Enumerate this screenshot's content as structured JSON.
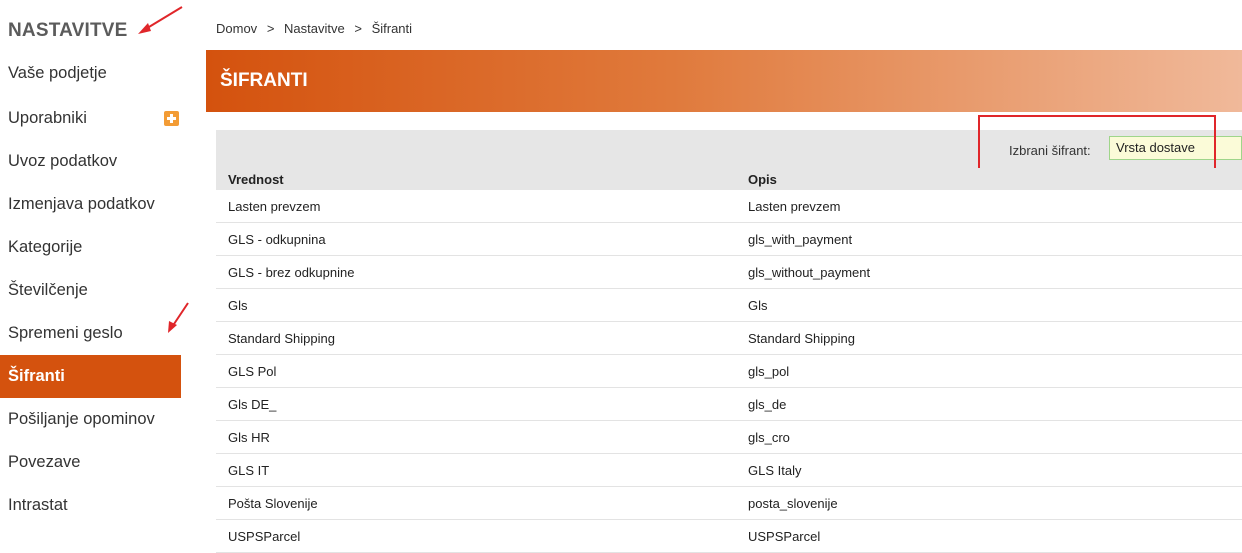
{
  "sidebar": {
    "title": "NASTAVITVE",
    "items": [
      {
        "label": "Vaše podjetje"
      },
      {
        "label": "Uporabniki"
      },
      {
        "label": "Uvoz podatkov"
      },
      {
        "label": "Izmenjava podatkov"
      },
      {
        "label": "Kategorije"
      },
      {
        "label": "Številčenje"
      },
      {
        "label": "Spremeni geslo"
      },
      {
        "label": "Šifranti"
      },
      {
        "label": "Pošiljanje opominov"
      },
      {
        "label": "Povezave"
      },
      {
        "label": "Intrastat"
      }
    ],
    "active_item": "Šifranti"
  },
  "breadcrumb": {
    "items": [
      "Domov",
      "Nastavitve",
      "Šifranti"
    ],
    "separator": ">"
  },
  "header": {
    "title": "ŠIFRANTI"
  },
  "filter": {
    "label": "Izbrani šifrant:",
    "value": "Vrsta dostave"
  },
  "table": {
    "columns": [
      "Vrednost",
      "Opis"
    ],
    "rows": [
      [
        "Lasten prevzem",
        "Lasten prevzem"
      ],
      [
        "GLS - odkupnina",
        "gls_with_payment"
      ],
      [
        "GLS - brez odkupnine",
        "gls_without_payment"
      ],
      [
        "Gls",
        "Gls"
      ],
      [
        "Standard Shipping",
        "Standard Shipping"
      ],
      [
        "GLS Pol",
        "gls_pol"
      ],
      [
        "Gls DE_",
        "gls_de"
      ],
      [
        "Gls HR",
        "gls_cro"
      ],
      [
        "GLS IT",
        "GLS Italy"
      ],
      [
        "Pošta Slovenije",
        "posta_slovenije"
      ],
      [
        "USPSParcel",
        "USPSParcel"
      ]
    ]
  },
  "colors": {
    "accent": "#d4520e",
    "annotation": "#e0262a"
  },
  "icons": {
    "uporabniki_action": "plus-icon"
  }
}
